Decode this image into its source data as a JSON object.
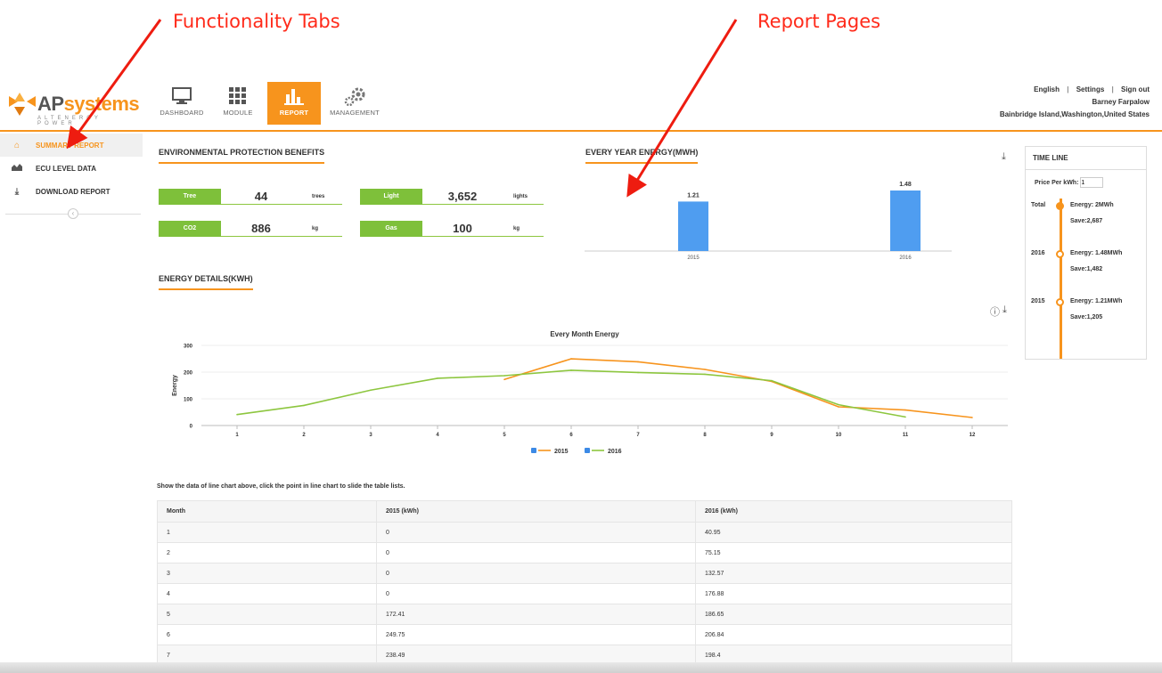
{
  "annotations": {
    "functionality_tabs": "Functionality Tabs",
    "report_pages": "Report Pages"
  },
  "logo": {
    "ap": "AP",
    "systems": "systems",
    "tagline": "ALTENERGY POWER"
  },
  "nav": {
    "tabs": [
      {
        "label": "DASHBOARD",
        "icon": "monitor-icon"
      },
      {
        "label": "MODULE",
        "icon": "grid-icon"
      },
      {
        "label": "REPORT",
        "icon": "bar-chart-icon",
        "active": true
      },
      {
        "label": "MANAGEMENT",
        "icon": "gears-icon"
      }
    ]
  },
  "topright": {
    "english": "English",
    "settings": "Settings",
    "signout": "Sign out",
    "user": "Barney Farpalow",
    "location": "Bainbridge Island,Washington,United States"
  },
  "sidebar": {
    "items": [
      {
        "label": "SUMMARY REPORT",
        "icon": "home-icon",
        "active": true
      },
      {
        "label": "ECU LEVEL DATA",
        "icon": "area-chart-icon"
      },
      {
        "label": "DOWNLOAD REPORT",
        "icon": "download-icon"
      }
    ]
  },
  "env": {
    "title": "ENVIRONMENTAL PROTECTION BENEFITS",
    "tree": {
      "label": "Tree",
      "value": "44",
      "unit": "trees"
    },
    "light": {
      "label": "Light",
      "value": "3,652",
      "unit": "lights"
    },
    "co2": {
      "label": "CO2",
      "value": "886",
      "unit": "kg"
    },
    "gas": {
      "label": "Gas",
      "value": "100",
      "unit": "kg"
    }
  },
  "year_energy": {
    "title": "EVERY YEAR ENERGY(MWh)"
  },
  "energy_details": {
    "title": "ENERGY DETAILS(kWh)"
  },
  "timeline": {
    "title": "TIME LINE",
    "price_label": "Price Per kWh:",
    "price_value": "1",
    "entries": [
      {
        "year": "Total",
        "energy": "Energy: 2MWh",
        "save": "Save:2,687"
      },
      {
        "year": "2016",
        "energy": "Energy: 1.48MWh",
        "save": "Save:1,482"
      },
      {
        "year": "2015",
        "energy": "Energy: 1.21MWh",
        "save": "Save:1,205"
      }
    ]
  },
  "chart_data": [
    {
      "type": "bar",
      "title": "",
      "categories": [
        "2015",
        "2016"
      ],
      "values": [
        1.21,
        1.48
      ],
      "data_labels": [
        "1.21",
        "1.48"
      ],
      "color": "#4f9df0"
    },
    {
      "type": "line",
      "title": "Every Month Energy",
      "ylabel": "Energy",
      "xlabel": "",
      "x": [
        1,
        2,
        3,
        4,
        5,
        6,
        7,
        8,
        9,
        10,
        11,
        12
      ],
      "yticks": [
        0,
        100,
        200,
        300
      ],
      "ylim": [
        0,
        300
      ],
      "legend_position": "bottom",
      "series": [
        {
          "name": "2015",
          "color": "#f7941d",
          "points": [
            [
              5,
              172.41
            ],
            [
              6,
              249.75
            ],
            [
              7,
              238.49
            ],
            [
              8,
              210
            ],
            [
              9,
              165
            ],
            [
              10,
              70
            ],
            [
              11,
              58
            ],
            [
              12,
              30
            ]
          ]
        },
        {
          "name": "2016",
          "color": "#8dc63f",
          "points": [
            [
              1,
              40.95
            ],
            [
              2,
              75.15
            ],
            [
              3,
              132.57
            ],
            [
              4,
              176.88
            ],
            [
              5,
              186.65
            ],
            [
              6,
              206.84
            ],
            [
              7,
              198.4
            ],
            [
              8,
              192
            ],
            [
              9,
              168
            ],
            [
              10,
              78
            ],
            [
              11,
              32
            ]
          ]
        }
      ]
    }
  ],
  "table": {
    "note": "Show the data of line chart above, click the point in line chart to slide the table lists.",
    "headers": [
      "Month",
      "2015 (kWh)",
      "2016 (kWh)"
    ],
    "rows": [
      [
        "1",
        "0",
        "40.95"
      ],
      [
        "2",
        "0",
        "75.15"
      ],
      [
        "3",
        "0",
        "132.57"
      ],
      [
        "4",
        "0",
        "176.88"
      ],
      [
        "5",
        "172.41",
        "186.65"
      ],
      [
        "6",
        "249.75",
        "206.84"
      ],
      [
        "7",
        "238.49",
        "198.4"
      ]
    ]
  }
}
